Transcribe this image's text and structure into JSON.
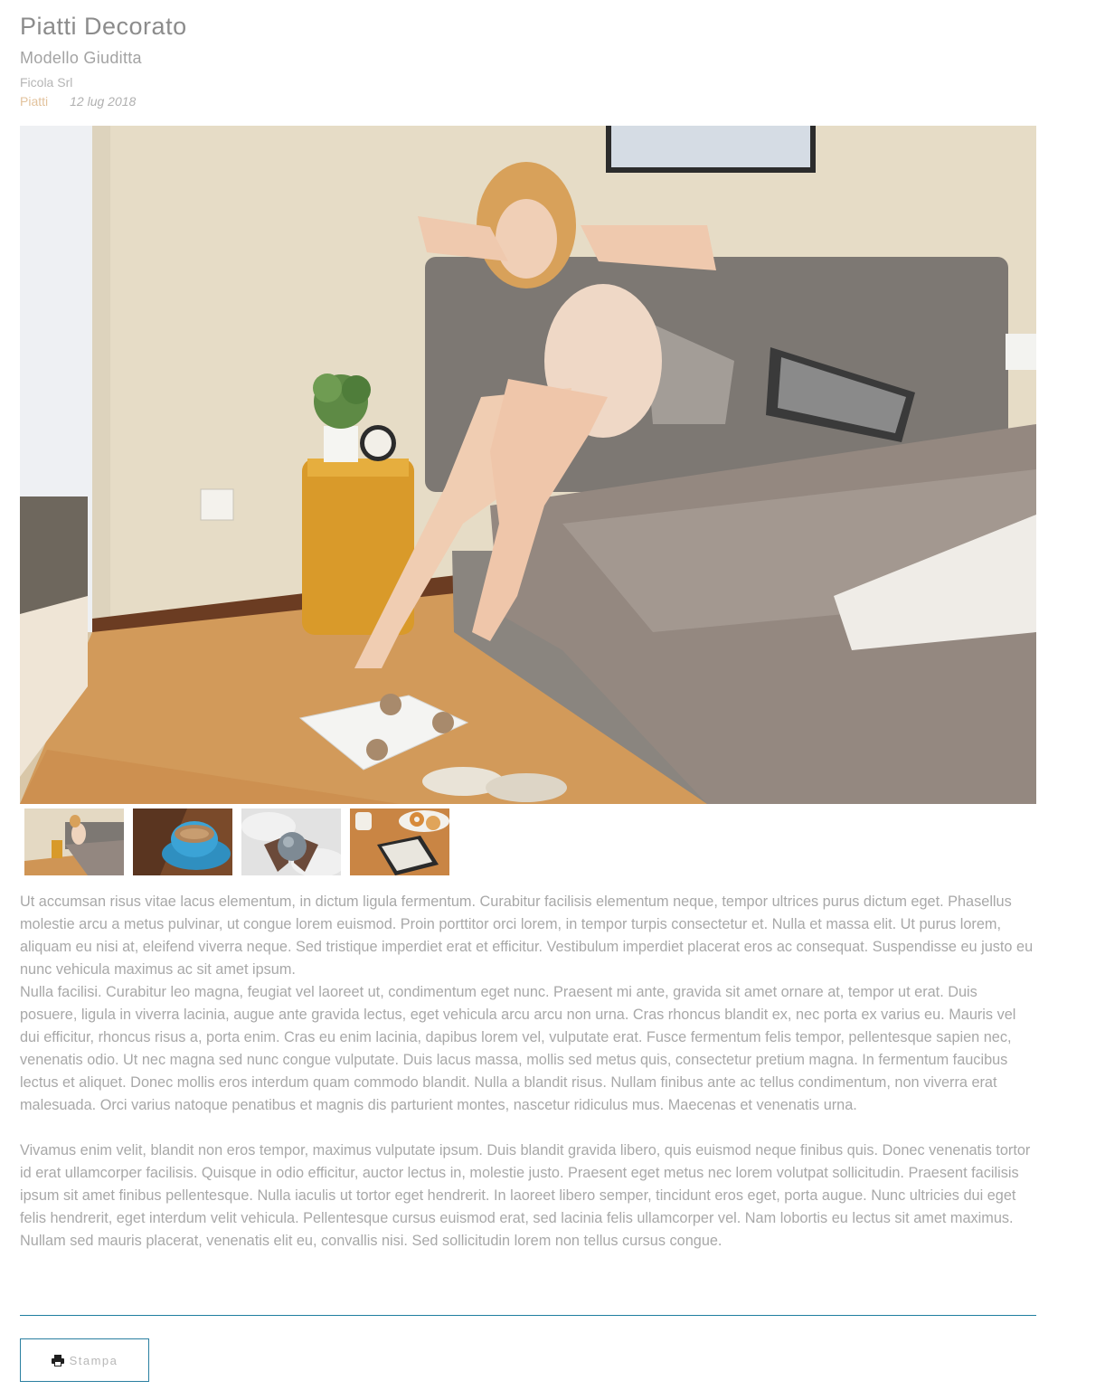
{
  "header": {
    "title": "Piatti Decorato",
    "subtitle": "Modello Giuditta",
    "company": "Ficola Srl",
    "category": "Piatti",
    "date": "12 lug 2018"
  },
  "gallery": {
    "main_image": "bedroom-morning-stretch-photo",
    "thumbnails": [
      {
        "name": "bedroom-thumbnail"
      },
      {
        "name": "coffee-cup-thumbnail"
      },
      {
        "name": "hands-ball-thumbnail"
      },
      {
        "name": "ereader-donuts-thumbnail"
      }
    ]
  },
  "content": {
    "paragraphs": [
      "Ut accumsan risus vitae lacus elementum, in dictum ligula fermentum. Curabitur facilisis elementum neque, tempor ultrices purus dictum eget. Phasellus molestie arcu a metus pulvinar, ut congue lorem euismod. Proin porttitor orci lorem, in tempor turpis consectetur et. Nulla et massa elit. Ut purus lorem, aliquam eu nisi at, eleifend viverra neque. Sed tristique imperdiet erat et efficitur. Vestibulum imperdiet placerat eros ac consequat. Suspendisse eu justo eu nunc vehicula maximus ac sit amet ipsum.",
      "Nulla facilisi. Curabitur leo magna, feugiat vel laoreet ut, condimentum eget nunc. Praesent mi ante, gravida sit amet ornare at, tempor ut erat. Duis posuere, ligula in viverra lacinia, augue ante gravida lectus, eget vehicula arcu arcu non urna. Cras rhoncus blandit ex, nec porta ex varius eu. Mauris vel dui efficitur, rhoncus risus a, porta enim. Cras eu enim lacinia, dapibus lorem vel, vulputate erat. Fusce fermentum felis tempor, pellentesque sapien nec, venenatis odio. Ut nec magna sed nunc congue vulputate. Duis lacus massa, mollis sed metus quis, consectetur pretium magna. In fermentum faucibus lectus et aliquet. Donec mollis eros interdum quam commodo blandit. Nulla a blandit risus. Nullam finibus ante ac tellus condimentum, non viverra erat malesuada. Orci varius natoque penatibus et magnis dis parturient montes, nascetur ridiculus mus. Maecenas et venenatis urna.",
      "Vivamus enim velit, blandit non eros tempor, maximus vulputate ipsum. Duis blandit gravida libero, quis euismod neque finibus quis. Donec venenatis tortor id erat ullamcorper facilisis. Quisque in odio efficitur, auctor lectus in, molestie justo. Praesent eget metus nec lorem volutpat sollicitudin. Praesent facilisis ipsum sit amet finibus pellentesque. Nulla iaculis ut tortor eget hendrerit. In laoreet libero semper, tincidunt eros eget, porta augue. Nunc ultricies dui eget felis hendrerit, eget interdum velit vehicula. Pellentesque cursus euismod erat, sed lacinia felis ullamcorper vel. Nam lobortis eu lectus sit amet maximus. Nullam sed mauris placerat, venenatis elit eu, convallis nisi. Sed sollicitudin lorem non tellus cursus congue."
    ]
  },
  "actions": {
    "print_label": "Stampa",
    "print_icon": "printer-icon"
  },
  "colors": {
    "accent": "#1f7fa0",
    "category": "#e2c29c",
    "text": "#a8a8a8"
  }
}
